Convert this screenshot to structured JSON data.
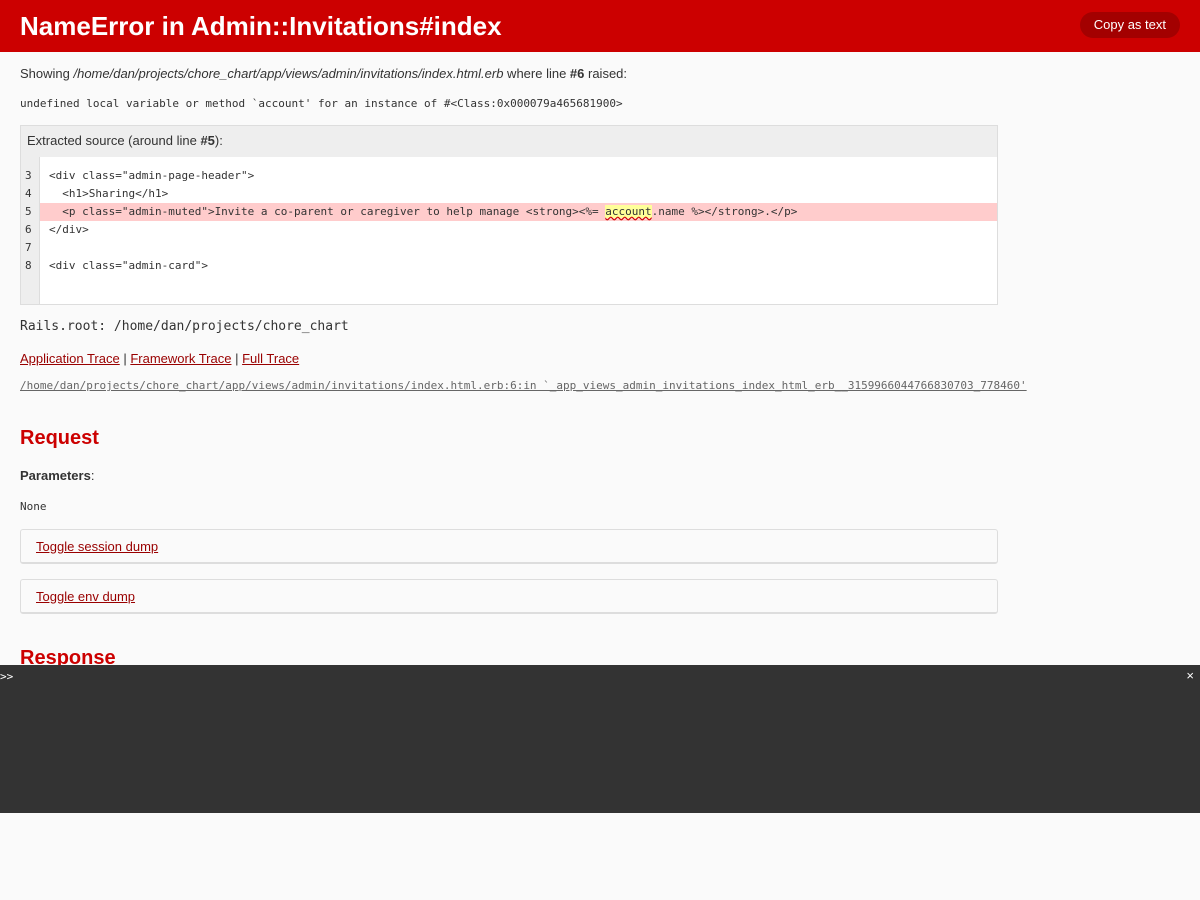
{
  "header": {
    "title": "NameError in Admin::Invitations#index",
    "copy_label": "Copy as text"
  },
  "showing": {
    "prefix": "Showing ",
    "path": "/home/dan/projects/chore_chart/app/views/admin/invitations/index.html.erb",
    "middle": " where line ",
    "line": "#6",
    "suffix": " raised:"
  },
  "error_message": "undefined local variable or method `account' for an instance of #<Class:0x000079a465681900>",
  "source": {
    "head_prefix": "Extracted source (around line ",
    "head_line": "#5",
    "head_suffix": "):",
    "lines": [
      {
        "no": "3",
        "code": "<div class=\"admin-page-header\">"
      },
      {
        "no": "4",
        "code": "  <h1>Sharing</h1>"
      },
      {
        "no": "5",
        "code_before": "  <p class=\"admin-muted\">Invite a co-parent or caregiver to help manage <strong><%= ",
        "code_mark": "account",
        "code_after": ".name %></strong>.</p>"
      },
      {
        "no": "6",
        "code": "</div>"
      },
      {
        "no": "7",
        "code": ""
      },
      {
        "no": "8",
        "code": "<div class=\"admin-card\">"
      }
    ]
  },
  "rails_root": "Rails.root: /home/dan/projects/chore_chart",
  "traces": {
    "application": "Application Trace",
    "framework": "Framework Trace",
    "full": "Full Trace",
    "separator": " | ",
    "first_line": "/home/dan/projects/chore_chart/app/views/admin/invitations/index.html.erb:6:in `_app_views_admin_invitations_index_html_erb__3159966044766830703_778460'"
  },
  "request": {
    "title": "Request",
    "params_label": "Parameters",
    "params_colon": ":",
    "params_value": "None",
    "session_toggle": "Toggle session dump",
    "env_toggle": "Toggle env dump"
  },
  "response": {
    "title": "Response"
  },
  "console": {
    "prompt": ">>",
    "close": "×"
  }
}
